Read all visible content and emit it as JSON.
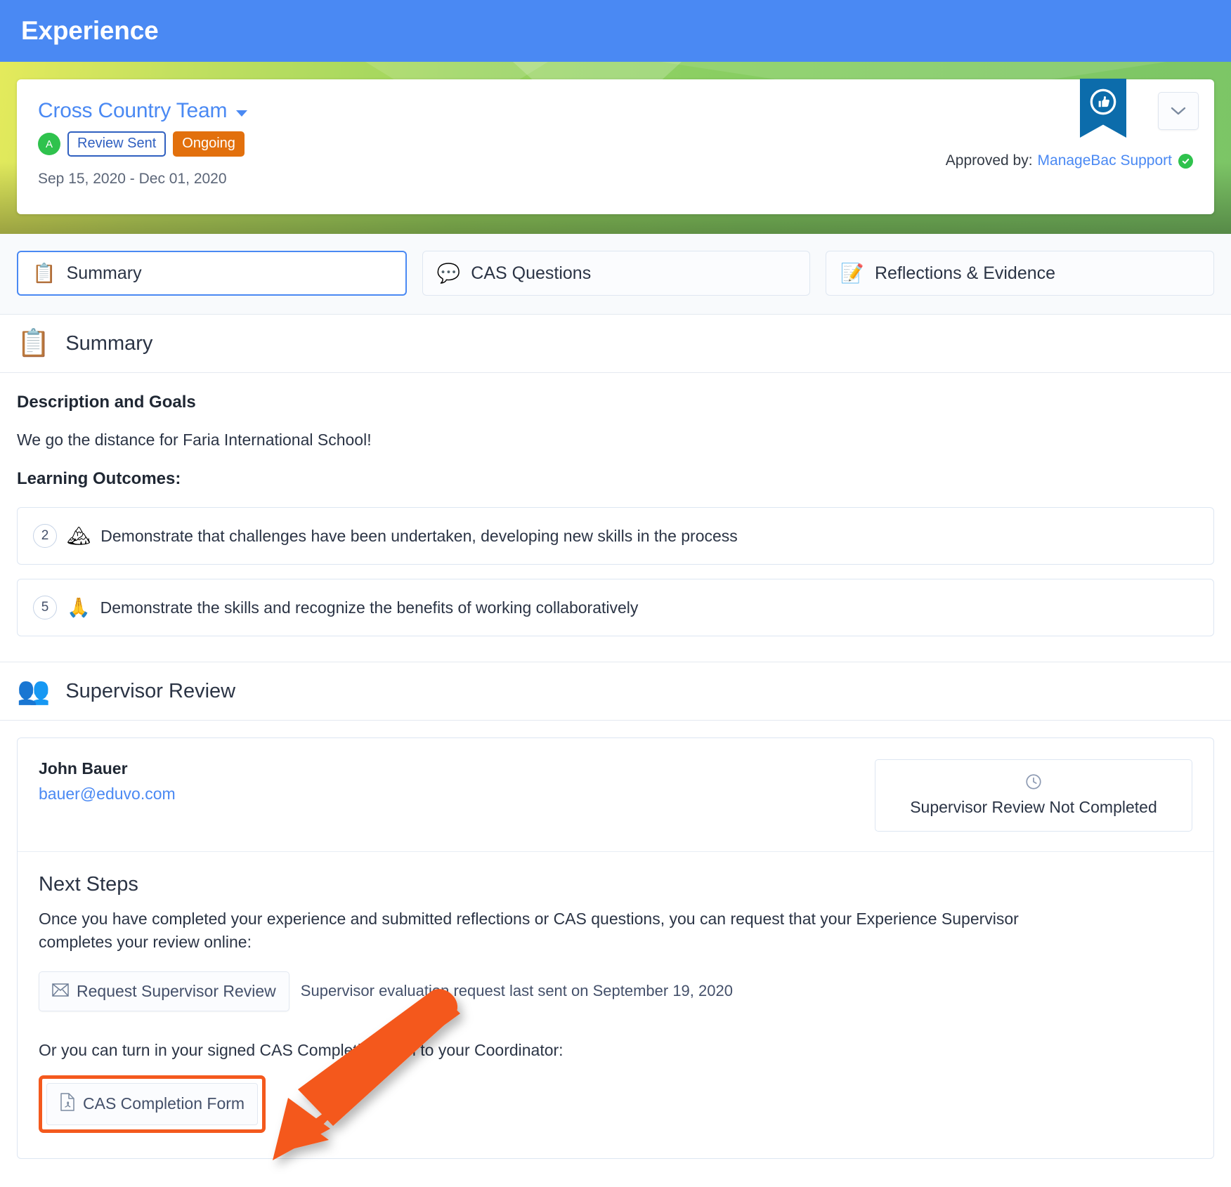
{
  "topbar": {
    "title": "Experience"
  },
  "experience": {
    "title": "Cross Country Team",
    "avatar_letter": "A",
    "status_outline": "Review Sent",
    "status_solid": "Ongoing",
    "dates": "Sep 15, 2020 - Dec 01, 2020",
    "approved_label": "Approved by:",
    "approved_by": "ManageBac Support",
    "ribbon_icon": "thumbs-up-icon",
    "chevron_icon": "chevron-down-icon",
    "verified_icon": "green-check-icon",
    "colors": {
      "topbar_blue": "#4a89f3",
      "ribbon_blue": "#0c6cab",
      "ongoing_orange": "#e2700d",
      "avatar_green": "#2fc24d",
      "link_blue": "#4a89f3"
    }
  },
  "tabs": [
    {
      "label": "Summary",
      "emoji": "📋",
      "icon": "clipboard-check-icon",
      "active": true
    },
    {
      "label": "CAS Questions",
      "emoji": "💬",
      "icon": "question-balloons-icon",
      "active": false
    },
    {
      "label": "Reflections & Evidence",
      "emoji": "📝",
      "icon": "memo-pencil-icon",
      "active": false
    }
  ],
  "summary_section": {
    "heading": "Summary",
    "emoji": "📋",
    "description_heading": "Description and Goals",
    "description_text": "We go the distance for Faria International School!",
    "learning_outcomes_heading": "Learning Outcomes:",
    "learning_outcomes": [
      {
        "number": "2",
        "emoji": "🏔",
        "text": "Demonstrate that challenges have been undertaken, developing new skills in the process"
      },
      {
        "number": "5",
        "emoji": "🙏",
        "text": "Demonstrate the skills and recognize the benefits of working collaboratively"
      }
    ]
  },
  "supervisor_section": {
    "heading": "Supervisor Review",
    "emoji": "👥",
    "supervisor_name": "John Bauer",
    "supervisor_email": "bauer@eduvo.com",
    "status_text": "Supervisor Review Not Completed",
    "status_icon": "clock-icon",
    "next_steps_title": "Next Steps",
    "next_steps_text": "Once you have completed your experience and submitted reflections or CAS questions, you can request that your Experience Supervisor completes your review online:",
    "request_button": "Request Supervisor Review",
    "request_button_icon": "envelope-icon",
    "last_sent_note": "Supervisor evaluation request last sent on September 19, 2020",
    "or_text": "Or you can turn in your signed CAS Completion form to your Coordinator:",
    "pdf_button": "CAS Completion Form",
    "pdf_button_icon": "pdf-file-icon",
    "highlight_color": "#f4591d"
  },
  "annotation": {
    "arrow_color": "#f4591d",
    "arrow_name": "orange-pointer-arrow"
  }
}
